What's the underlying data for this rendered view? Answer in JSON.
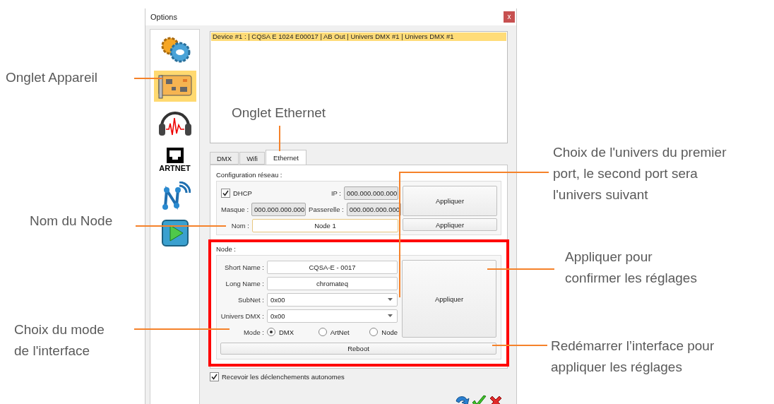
{
  "window": {
    "title": "Options",
    "close": "x"
  },
  "sidebar": {
    "items": [
      {
        "kind": "gears",
        "selected": false
      },
      {
        "kind": "board",
        "selected": true
      },
      {
        "kind": "headphones",
        "selected": false
      },
      {
        "kind": "artnet",
        "label": "ARTNET",
        "selected": false
      },
      {
        "kind": "network",
        "selected": false
      },
      {
        "kind": "play",
        "selected": false
      }
    ]
  },
  "device_list": {
    "rows": [
      {
        "text": "Device #1 :  | CQSA E 1024 E00017 | AB Out | Univers DMX #1 | Univers DMX #1",
        "selected": true
      }
    ]
  },
  "tabs": [
    {
      "label": "DMX",
      "selected": false
    },
    {
      "label": "Wifi",
      "selected": false
    },
    {
      "label": "Ethernet",
      "selected": true
    }
  ],
  "network_config": {
    "title": "Configuration réseau :",
    "dhcp": {
      "label": "DHCP",
      "checked": true
    },
    "ip": {
      "label": "IP :",
      "value": "000.000.000.000",
      "disabled": true
    },
    "mask": {
      "label": "Masque :",
      "value": "000.000.000.000",
      "disabled": true
    },
    "gateway": {
      "label": "Passerelle :",
      "value": "000.000.000.000",
      "disabled": true
    },
    "apply_button": "Appliquer",
    "name": {
      "label": "Nom :",
      "value": "Node 1"
    },
    "name_apply_button": "Appliquer"
  },
  "node": {
    "title": "Node :",
    "short_name": {
      "label": "Short Name :",
      "value": "CQSA-E - 0017"
    },
    "long_name": {
      "label": "Long Name :",
      "value": "chromateq"
    },
    "subnet": {
      "label": "SubNet :",
      "value": "0x00"
    },
    "universe": {
      "label": "Univers DMX :",
      "value": "0x00"
    },
    "mode": {
      "label": "Mode :",
      "options": [
        {
          "label": "DMX",
          "selected": true
        },
        {
          "label": "ArtNet",
          "selected": false
        },
        {
          "label": "Node",
          "selected": false
        }
      ]
    },
    "apply_button": "Appliquer",
    "reboot_button": "Reboot"
  },
  "autonomous_triggers": {
    "label": "Recevoir les déclenchements autonomes",
    "checked": true
  },
  "annotations": [
    {
      "lines": [
        "Onglet Appareil"
      ]
    },
    {
      "lines": [
        "Onglet Ethernet"
      ]
    },
    {
      "lines": [
        "Choix de l'univers du premier",
        "port, le second port sera",
        "l'univers suivant"
      ]
    },
    {
      "lines": [
        "Nom du Node"
      ]
    },
    {
      "lines": [
        "Appliquer pour",
        "confirmer les réglages"
      ]
    },
    {
      "lines": [
        "Choix du mode",
        "de l'interface"
      ]
    },
    {
      "lines": [
        "Redémarrer l’interface pour",
        "appliquer les réglages"
      ]
    }
  ]
}
